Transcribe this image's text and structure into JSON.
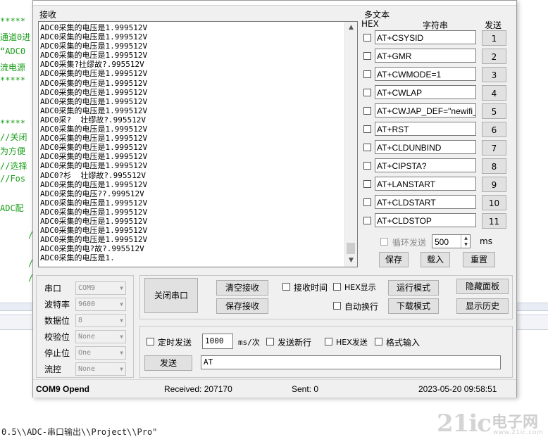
{
  "background": {
    "code_lines": [
      "通道0进",
      "“ADC0",
      "流电源",
      "*****",
      "*****",
      "//关闭",
      "为方便",
      "//选择",
      "//Fos",
      "ADC配",
      "/",
      "/",
      "/"
    ],
    "path_text": "0.5\\\\ADC-串口输出\\\\Project\\\\Pro\"",
    "watermark": {
      "big": "21ic",
      "cn": "电子网",
      "url": "www.21ic.com"
    }
  },
  "receive": {
    "label": "接收",
    "lines": [
      "ADC0采集的电压是1.999512V",
      "ADC0采集的电压是1.999512V",
      "ADC0采集的电压是1.999512V",
      "ADC0采集的电压是1.999512V",
      "ADC0采集?扗缪故?.995512V",
      "ADC0采集的电压是1.999512V",
      "ADC0采集的电压是1.999512V",
      "ADC0采集的电压是1.999512V",
      "ADC0采集的电压是1.999512V",
      "ADC0采集的电压是1.999512V",
      "ADC0采?  壮缪故?.995512V",
      "ADC0采集的电压是1.999512V",
      "ADC0采集的电压是1.999512V",
      "ADC0采集的电压是1.999512V",
      "ADC0采集的电压是1.999512V",
      "ADC0采集的电压是1.999512V",
      "ADC0?杉  壮缪故?.995512V",
      "ADC0采集的电压是1.999512V",
      "ADC0采集的电压??.999512V",
      "ADC0采集的电压是1.999512V",
      "ADC0采集的电压是1.999512V",
      "ADC0采集的电压是1.999512V",
      "ADC0采集的电压是1.999512V",
      "ADC0采集的电压是1.999512V",
      "ADC0采集的电?故?.995512V",
      "ADC0采集的电压是1."
    ]
  },
  "multitext": {
    "label": "多文本",
    "col_hex": "HEX",
    "col_string": "字符串",
    "col_send": "发送",
    "rows": [
      {
        "cmd": "AT+CSYSID",
        "num": "1"
      },
      {
        "cmd": "AT+GMR",
        "num": "2"
      },
      {
        "cmd": "AT+CWMODE=1",
        "num": "3"
      },
      {
        "cmd": "AT+CWLAP",
        "num": "4"
      },
      {
        "cmd": "AT+CWJAP_DEF=\"newifi_",
        "num": "5"
      },
      {
        "cmd": "AT+RST",
        "num": "6"
      },
      {
        "cmd": "AT+CLDUNBIND",
        "num": "7"
      },
      {
        "cmd": "AT+CIPSTA?",
        "num": "8"
      },
      {
        "cmd": "AT+LANSTART",
        "num": "9"
      },
      {
        "cmd": "AT+CLDSTART",
        "num": "10"
      },
      {
        "cmd": "AT+CLDSTOP",
        "num": "11"
      }
    ],
    "loop_send_label": "循环发送",
    "loop_interval": "500",
    "loop_unit": "ms",
    "save_label": "保存",
    "load_label": "载入",
    "reset_label": "重置"
  },
  "port": {
    "fields": [
      {
        "label": "串口",
        "value": "COM9"
      },
      {
        "label": "波特率",
        "value": "9600"
      },
      {
        "label": "数据位",
        "value": "8"
      },
      {
        "label": "校验位",
        "value": "None"
      },
      {
        "label": "停止位",
        "value": "One"
      },
      {
        "label": "流控",
        "value": "None"
      }
    ],
    "close_port_label": "关闭串口"
  },
  "controls": {
    "clear_rx": "清空接收",
    "save_rx": "保存接收",
    "rx_time": "接收时间",
    "hex_display": "HEX显示",
    "auto_wrap": "自动换行",
    "run_mode": "运行模式",
    "download_mode": "下载模式",
    "hide_panel": "隐藏面板",
    "show_history": "显示历史"
  },
  "send": {
    "timed_send": "定时发送",
    "interval": "1000",
    "interval_unit": "ms/次",
    "newline": "发送新行",
    "hex_send": "HEX发送",
    "format_input": "格式输入",
    "send_button": "发送",
    "text": "AT"
  },
  "status": {
    "port": "COM9 Opend",
    "received": "Received: 207170",
    "sent": "Sent: 0",
    "datetime": "2023-05-20 09:58:51"
  }
}
